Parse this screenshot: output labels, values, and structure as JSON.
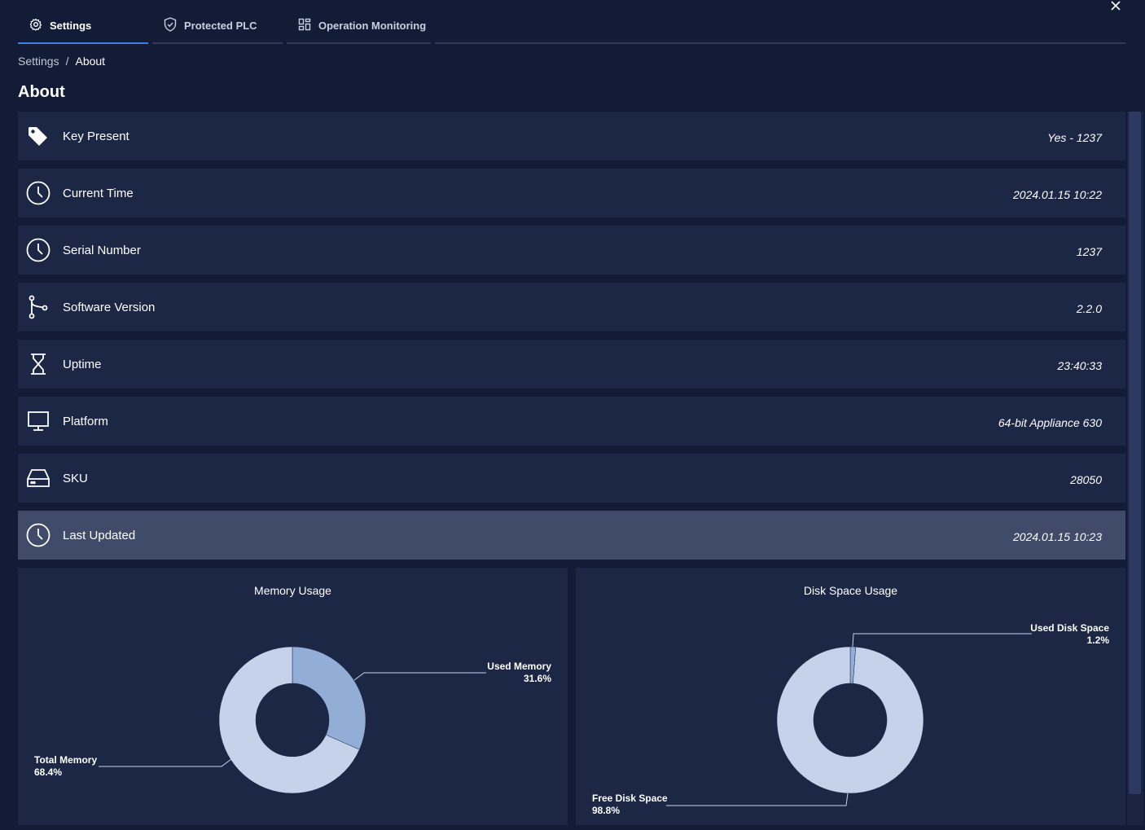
{
  "tabs": [
    {
      "label": "Settings",
      "icon": "gear-icon",
      "active": true
    },
    {
      "label": "Protected PLC",
      "icon": "shield-check-icon",
      "active": false
    },
    {
      "label": "Operation Monitoring",
      "icon": "dashboard-grid-icon",
      "active": false
    }
  ],
  "breadcrumb": {
    "parent": "Settings",
    "separator": "/",
    "current": "About"
  },
  "page_title": "About",
  "info_rows": [
    {
      "label": "Key Present",
      "value": "Yes - 1237",
      "icon": "tag-icon"
    },
    {
      "label": "Current Time",
      "value": "2024.01.15 10:22",
      "icon": "clock-icon"
    },
    {
      "label": "Serial Number",
      "value": "1237",
      "icon": "clock-icon"
    },
    {
      "label": "Software Version",
      "value": "2.2.0",
      "icon": "git-branch-icon"
    },
    {
      "label": "Uptime",
      "value": "23:40:33",
      "icon": "hourglass-icon"
    },
    {
      "label": "Platform",
      "value": "64-bit Appliance 630",
      "icon": "monitor-icon"
    },
    {
      "label": "SKU",
      "value": "28050",
      "icon": "hard-drive-icon"
    },
    {
      "label": "Last Updated",
      "value": "2024.01.15 10:23",
      "icon": "clock-icon"
    }
  ],
  "colors": {
    "background": "#131c36",
    "row_background": "#1c2746",
    "row_highlight": "#3f4b68",
    "accent": "#3c7de6",
    "donut_light": "#c6d2ea",
    "donut_mid": "#93aed6"
  },
  "chart_data": [
    {
      "type": "pie",
      "title": "Memory Usage",
      "slices": [
        {
          "name": "Used Memory",
          "value": 31.6,
          "label": "31.6%"
        },
        {
          "name": "Total Memory",
          "value": 68.4,
          "label": "68.4%"
        }
      ],
      "donut": true
    },
    {
      "type": "pie",
      "title": "Disk Space Usage",
      "slices": [
        {
          "name": "Used Disk Space",
          "value": 1.2,
          "label": "1.2%"
        },
        {
          "name": "Free Disk Space",
          "value": 98.8,
          "label": "98.8%"
        }
      ],
      "donut": true
    }
  ]
}
